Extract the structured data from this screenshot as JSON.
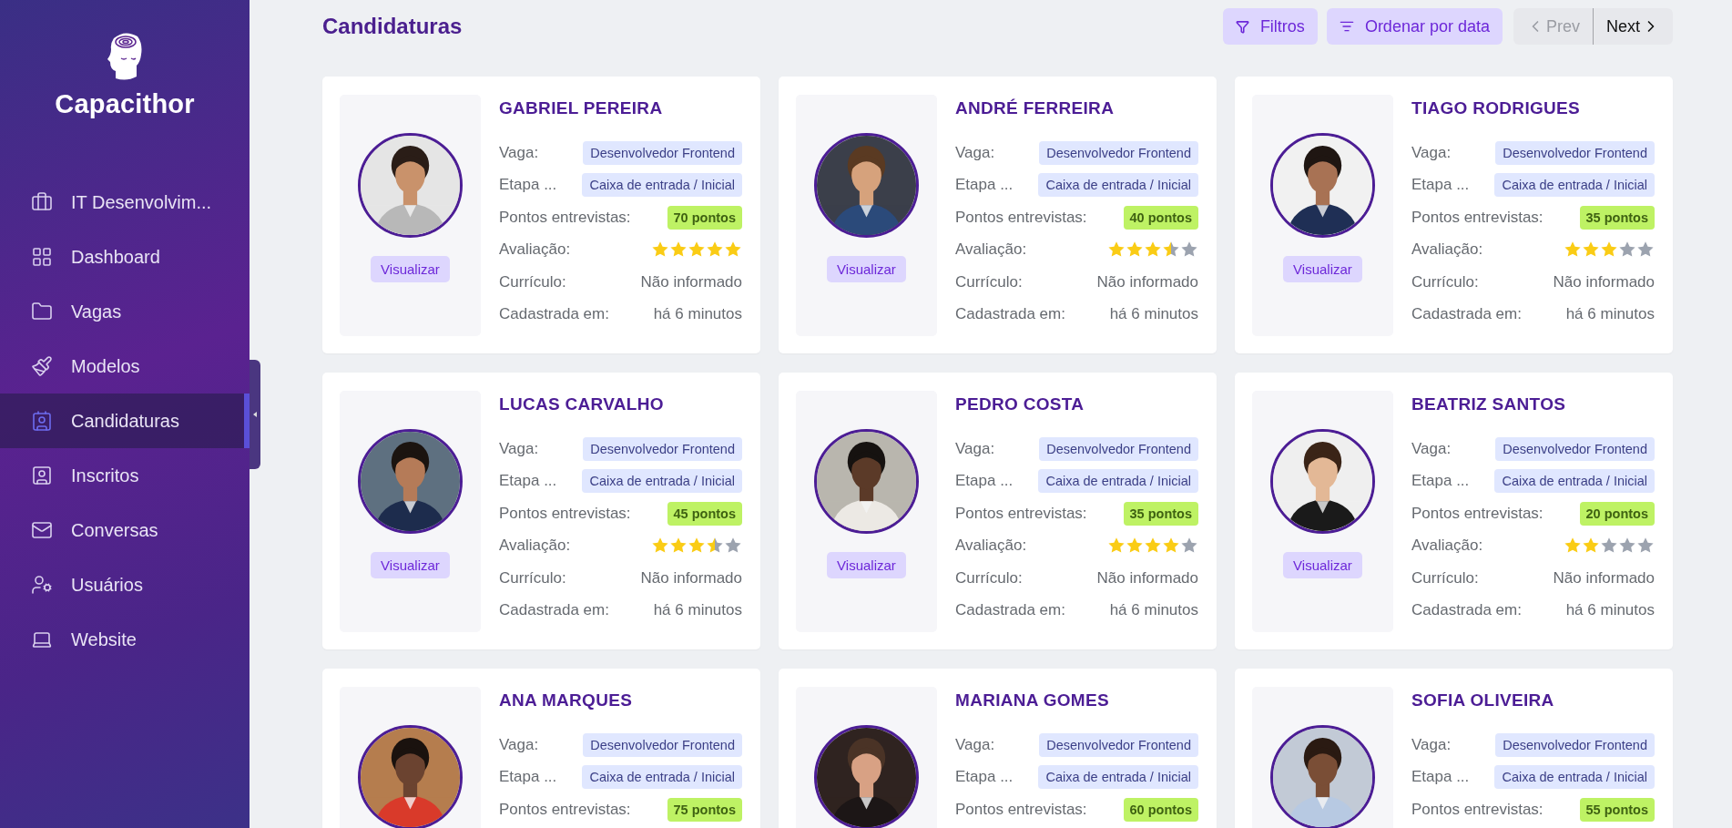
{
  "brand": {
    "name": "Capacithor"
  },
  "sidebar": {
    "items": [
      {
        "label": "IT Desenvolvim...",
        "selected": false
      },
      {
        "label": "Dashboard",
        "selected": false
      },
      {
        "label": "Vagas",
        "selected": false
      },
      {
        "label": "Modelos",
        "selected": false
      },
      {
        "label": "Candidaturas",
        "selected": true
      },
      {
        "label": "Inscritos",
        "selected": false
      },
      {
        "label": "Conversas",
        "selected": false
      },
      {
        "label": "Usuários",
        "selected": false
      },
      {
        "label": "Website",
        "selected": false
      }
    ]
  },
  "header": {
    "title": "Candidaturas",
    "filter_button": "Filtros",
    "sort_button": "Ordenar por data",
    "pagination": [
      {
        "label": "Prev",
        "kind": "prev",
        "disabled": true
      },
      {
        "label": "Next",
        "kind": "next",
        "disabled": false
      }
    ]
  },
  "candidates": [
    {
      "name": "GABRIEL PEREIRA",
      "button": "Visualizar",
      "fields": [
        {
          "kind": "chip",
          "label": "Vaga:",
          "value": "Desenvolvedor Frontend"
        },
        {
          "kind": "chip",
          "label": "Etapa ...",
          "value": "Caixa de entrada / Inicial"
        },
        {
          "kind": "points",
          "label": "Pontos entrevistas:",
          "value": "70 pontos"
        },
        {
          "kind": "stars",
          "label": "Avaliação:",
          "stars": 5
        },
        {
          "kind": "text",
          "label": "Currículo:",
          "value": "Não informado"
        },
        {
          "kind": "text",
          "label": "Cadastrada em:",
          "value": "há 6 minutos"
        }
      ]
    },
    {
      "name": "ANDRÉ FERREIRA",
      "button": "Visualizar",
      "fields": [
        {
          "kind": "chip",
          "label": "Vaga:",
          "value": "Desenvolvedor Frontend"
        },
        {
          "kind": "chip",
          "label": "Etapa ...",
          "value": "Caixa de entrada / Inicial"
        },
        {
          "kind": "points",
          "label": "Pontos entrevistas:",
          "value": "40 pontos"
        },
        {
          "kind": "stars",
          "label": "Avaliação:",
          "stars": 3.5
        },
        {
          "kind": "text",
          "label": "Currículo:",
          "value": "Não informado"
        },
        {
          "kind": "text",
          "label": "Cadastrada em:",
          "value": "há 6 minutos"
        }
      ]
    },
    {
      "name": "TIAGO RODRIGUES",
      "button": "Visualizar",
      "fields": [
        {
          "kind": "chip",
          "label": "Vaga:",
          "value": "Desenvolvedor Frontend"
        },
        {
          "kind": "chip",
          "label": "Etapa ...",
          "value": "Caixa de entrada / Inicial"
        },
        {
          "kind": "points",
          "label": "Pontos entrevistas:",
          "value": "35 pontos"
        },
        {
          "kind": "stars",
          "label": "Avaliação:",
          "stars": 3
        },
        {
          "kind": "text",
          "label": "Currículo:",
          "value": "Não informado"
        },
        {
          "kind": "text",
          "label": "Cadastrada em:",
          "value": "há 6 minutos"
        }
      ]
    },
    {
      "name": "LUCAS CARVALHO",
      "button": "Visualizar",
      "fields": [
        {
          "kind": "chip",
          "label": "Vaga:",
          "value": "Desenvolvedor Frontend"
        },
        {
          "kind": "chip",
          "label": "Etapa ...",
          "value": "Caixa de entrada / Inicial"
        },
        {
          "kind": "points",
          "label": "Pontos entrevistas:",
          "value": "45 pontos"
        },
        {
          "kind": "stars",
          "label": "Avaliação:",
          "stars": 3.5
        },
        {
          "kind": "text",
          "label": "Currículo:",
          "value": "Não informado"
        },
        {
          "kind": "text",
          "label": "Cadastrada em:",
          "value": "há 6 minutos"
        }
      ]
    },
    {
      "name": "PEDRO COSTA",
      "button": "Visualizar",
      "fields": [
        {
          "kind": "chip",
          "label": "Vaga:",
          "value": "Desenvolvedor Frontend"
        },
        {
          "kind": "chip",
          "label": "Etapa ...",
          "value": "Caixa de entrada / Inicial"
        },
        {
          "kind": "points",
          "label": "Pontos entrevistas:",
          "value": "35 pontos"
        },
        {
          "kind": "stars",
          "label": "Avaliação:",
          "stars": 4
        },
        {
          "kind": "text",
          "label": "Currículo:",
          "value": "Não informado"
        },
        {
          "kind": "text",
          "label": "Cadastrada em:",
          "value": "há 6 minutos"
        }
      ]
    },
    {
      "name": "BEATRIZ SANTOS",
      "button": "Visualizar",
      "fields": [
        {
          "kind": "chip",
          "label": "Vaga:",
          "value": "Desenvolvedor Frontend"
        },
        {
          "kind": "chip",
          "label": "Etapa ...",
          "value": "Caixa de entrada / Inicial"
        },
        {
          "kind": "points",
          "label": "Pontos entrevistas:",
          "value": "20 pontos"
        },
        {
          "kind": "stars",
          "label": "Avaliação:",
          "stars": 2
        },
        {
          "kind": "text",
          "label": "Currículo:",
          "value": "Não informado"
        },
        {
          "kind": "text",
          "label": "Cadastrada em:",
          "value": "há 6 minutos"
        }
      ]
    },
    {
      "name": "ANA MARQUES",
      "fields": [
        {
          "kind": "chip",
          "label": "Vaga:",
          "value": "Desenvolvedor Frontend"
        },
        {
          "kind": "chip",
          "label": "Etapa ...",
          "value": "Caixa de entrada / Inicial"
        },
        {
          "kind": "points",
          "label": "Pontos entrevistas:",
          "value": "75 pontos"
        }
      ]
    },
    {
      "name": "MARIANA GOMES",
      "fields": [
        {
          "kind": "chip",
          "label": "Vaga:",
          "value": "Desenvolvedor Frontend"
        },
        {
          "kind": "chip",
          "label": "Etapa ...",
          "value": "Caixa de entrada / Inicial"
        },
        {
          "kind": "points",
          "label": "Pontos entrevistas:",
          "value": "60 pontos"
        }
      ]
    },
    {
      "name": "SOFIA OLIVEIRA",
      "fields": [
        {
          "kind": "chip",
          "label": "Vaga:",
          "value": "Desenvolvedor Frontend"
        },
        {
          "kind": "chip",
          "label": "Etapa ...",
          "value": "Caixa de entrada / Inicial"
        },
        {
          "kind": "points",
          "label": "Pontos entrevistas:",
          "value": "55 pontos"
        }
      ]
    }
  ]
}
